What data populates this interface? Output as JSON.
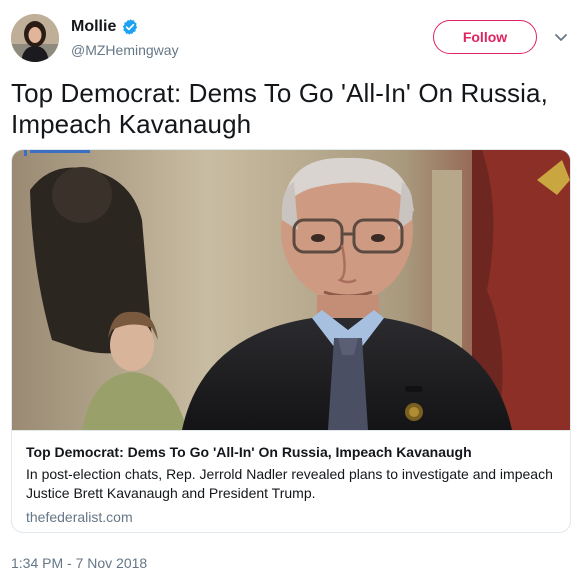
{
  "author": {
    "display_name": "Mollie",
    "handle": "@MZHemingway",
    "verified": true,
    "avatar_icon": "profile-photo"
  },
  "actions": {
    "follow_label": "Follow",
    "menu_icon": "chevron-down-icon"
  },
  "tweet": {
    "text": "Top Democrat: Dems To Go 'All-In' On Russia, Impeach Kavanaugh",
    "timestamp": "1:34 PM - 7 Nov 2018"
  },
  "card": {
    "image_subject": "man-in-suit-portrait",
    "title": "Top Democrat: Dems To Go 'All-In' On Russia, Impeach Kavanaugh",
    "description": "In post-election chats, Rep. Jerrold Nadler revealed plans to investigate and impeach Justice Brett Kavanaugh and President Trump.",
    "domain": "thefederalist.com"
  },
  "colors": {
    "follow_accent": "#e0245e",
    "verified_blue": "#1da1f2",
    "secondary_text": "#657786",
    "primary_text": "#14171a",
    "border": "#e1e8ed"
  }
}
